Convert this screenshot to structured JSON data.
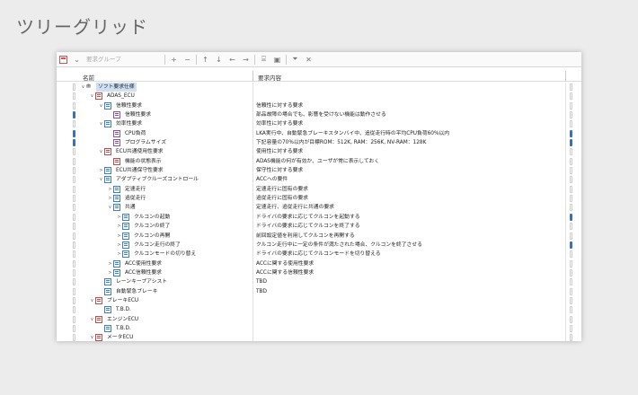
{
  "page_title": "ツリーグリッド",
  "toolbar": {
    "search_placeholder": "要求グループ"
  },
  "columns": {
    "name": "名前",
    "content": "要求内容"
  },
  "rows": [
    {
      "depth": 0,
      "toggle": "∨",
      "icon": "group",
      "name": "ソフト要求仕様",
      "content": "",
      "selected": true,
      "lmark": false,
      "rmark": false
    },
    {
      "depth": 1,
      "toggle": "∨",
      "icon": "red",
      "name": "ADAS_ECU",
      "content": "",
      "lmark": false,
      "rmark": false
    },
    {
      "depth": 2,
      "toggle": "∨",
      "icon": "blue",
      "name": "信頼性要求",
      "content": "信頼性に対する要求",
      "lmark": false,
      "rmark": false
    },
    {
      "depth": 3,
      "toggle": "",
      "icon": "purple",
      "name": "信頼性要求",
      "content": "部品故障の場合でも、影響を受けない機能は動作させる",
      "lmark": true,
      "rmark": false
    },
    {
      "depth": 2,
      "toggle": "∨",
      "icon": "blue",
      "name": "効率性要求",
      "content": "効率性に対する要求",
      "lmark": false,
      "rmark": false
    },
    {
      "depth": 3,
      "toggle": "",
      "icon": "purple",
      "name": "CPU負荷",
      "content": "LKA実行中、自動緊急ブレーキスタンバイ中、追従走行時の平均CPU負荷60%以内",
      "lmark": true,
      "rmark": true
    },
    {
      "depth": 3,
      "toggle": "",
      "icon": "purple",
      "name": "プログラムサイズ",
      "content": "下記容量の70%以内が目標ROM：512K, RAM：256K, NV-RAM：128K",
      "lmark": true,
      "rmark": true
    },
    {
      "depth": 2,
      "toggle": "∨",
      "icon": "red",
      "name": "ECU共通使用性要求",
      "content": "使用性に対する要求",
      "lmark": false,
      "rmark": false
    },
    {
      "depth": 3,
      "toggle": "",
      "icon": "red",
      "name": "機能の状態表示",
      "content": "ADAS機能の何が有効か、ユーザが常に表示しておく",
      "lmark": false,
      "rmark": false
    },
    {
      "depth": 2,
      "toggle": ">",
      "icon": "blue",
      "name": "ECU共通保守性要求",
      "content": "保守性に対する要求",
      "lmark": false,
      "rmark": false
    },
    {
      "depth": 2,
      "toggle": "∨",
      "icon": "blue",
      "name": "アダプティブクルーズコントロール",
      "content": "ACCへの要件",
      "lmark": false,
      "rmark": false
    },
    {
      "depth": 3,
      "toggle": ">",
      "icon": "blue",
      "name": "定速走行",
      "content": "定速走行に固有の要求",
      "lmark": false,
      "rmark": false
    },
    {
      "depth": 3,
      "toggle": ">",
      "icon": "blue",
      "name": "追従走行",
      "content": "追従走行に固有の要求",
      "lmark": false,
      "rmark": false
    },
    {
      "depth": 3,
      "toggle": "∨",
      "icon": "blue",
      "name": "共通",
      "content": "定速走行、追従走行に共通の要求",
      "lmark": false,
      "rmark": false
    },
    {
      "depth": 4,
      "toggle": ">",
      "icon": "blue",
      "name": "クルコンの起動",
      "content": "ドライバの要求に応じてクルコンを起動する",
      "lmark": false,
      "rmark": true
    },
    {
      "depth": 4,
      "toggle": ">",
      "icon": "blue",
      "name": "クルコンの終了",
      "content": "ドライバの要求に応じてクルコンを終了する",
      "lmark": false,
      "rmark": false
    },
    {
      "depth": 4,
      "toggle": ">",
      "icon": "blue",
      "name": "クルコンの再開",
      "content": "前回設定値を利用してクルコンを再開する",
      "lmark": false,
      "rmark": false
    },
    {
      "depth": 4,
      "toggle": ">",
      "icon": "blue",
      "name": "クルコン走行の終了",
      "content": "クルコン走行中に一定の条件が満たされた場合、クルコンを終了させる",
      "lmark": false,
      "rmark": true
    },
    {
      "depth": 4,
      "toggle": ">",
      "icon": "blue",
      "name": "クルコンモードの切り替え",
      "content": "ドライバの要求に応じてクルコンモードを切り替える",
      "lmark": false,
      "rmark": false
    },
    {
      "depth": 3,
      "toggle": ">",
      "icon": "blue",
      "name": "ACC使用性要求",
      "content": "ACCに関する使用性要求",
      "lmark": false,
      "rmark": false
    },
    {
      "depth": 3,
      "toggle": ">",
      "icon": "blue",
      "name": "ACC信頼性要求",
      "content": "ACCに関する信頼性要求",
      "lmark": false,
      "rmark": false
    },
    {
      "depth": 2,
      "toggle": "",
      "icon": "blue",
      "name": "レーンキープアシスト",
      "content": "TBD",
      "lmark": false,
      "rmark": false
    },
    {
      "depth": 2,
      "toggle": "",
      "icon": "blue",
      "name": "自動緊急ブレーキ",
      "content": "TBD",
      "lmark": false,
      "rmark": false
    },
    {
      "depth": 1,
      "toggle": "∨",
      "icon": "red",
      "name": "ブレーキECU",
      "content": "",
      "lmark": false,
      "rmark": false
    },
    {
      "depth": 2,
      "toggle": "",
      "icon": "blue",
      "name": "T.B.D.",
      "content": "",
      "lmark": false,
      "rmark": false
    },
    {
      "depth": 1,
      "toggle": "∨",
      "icon": "red",
      "name": "エンジンECU",
      "content": "",
      "lmark": false,
      "rmark": false
    },
    {
      "depth": 2,
      "toggle": "",
      "icon": "blue",
      "name": "T.B.D.",
      "content": "",
      "lmark": false,
      "rmark": false
    },
    {
      "depth": 1,
      "toggle": "∨",
      "icon": "red",
      "name": "メータECU",
      "content": "",
      "lmark": false,
      "rmark": false
    }
  ]
}
